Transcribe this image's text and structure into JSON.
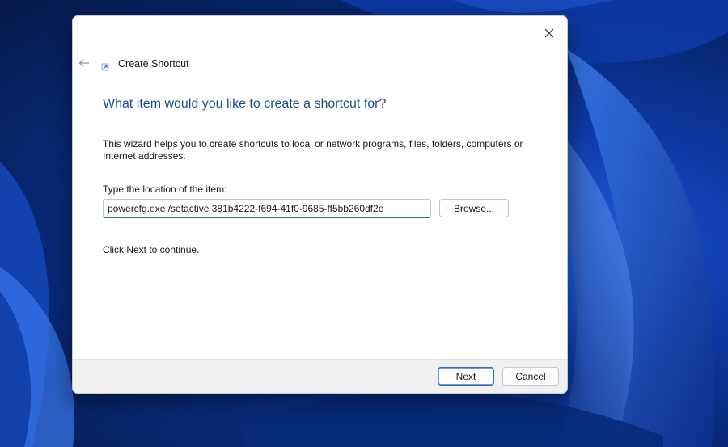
{
  "dialog": {
    "title": "Create Shortcut",
    "heading": "What item would you like to create a shortcut for?",
    "description": "This wizard helps you to create shortcuts to local or network programs, files, folders, computers or Internet addresses.",
    "location_label": "Type the location of the item:",
    "location_value": "powercfg.exe /setactive 381b4222-f694-41f0-9685-ff5bb260df2e",
    "browse_label": "Browse...",
    "continue_text": "Click Next to continue.",
    "next_label": "Next",
    "cancel_label": "Cancel"
  },
  "icons": {
    "close": "close-icon",
    "back": "back-arrow-icon",
    "title": "shortcut-icon"
  },
  "colors": {
    "accent": "#2c6cbf",
    "heading": "#1f4e8c",
    "footer_bg": "#f0f0f0"
  }
}
